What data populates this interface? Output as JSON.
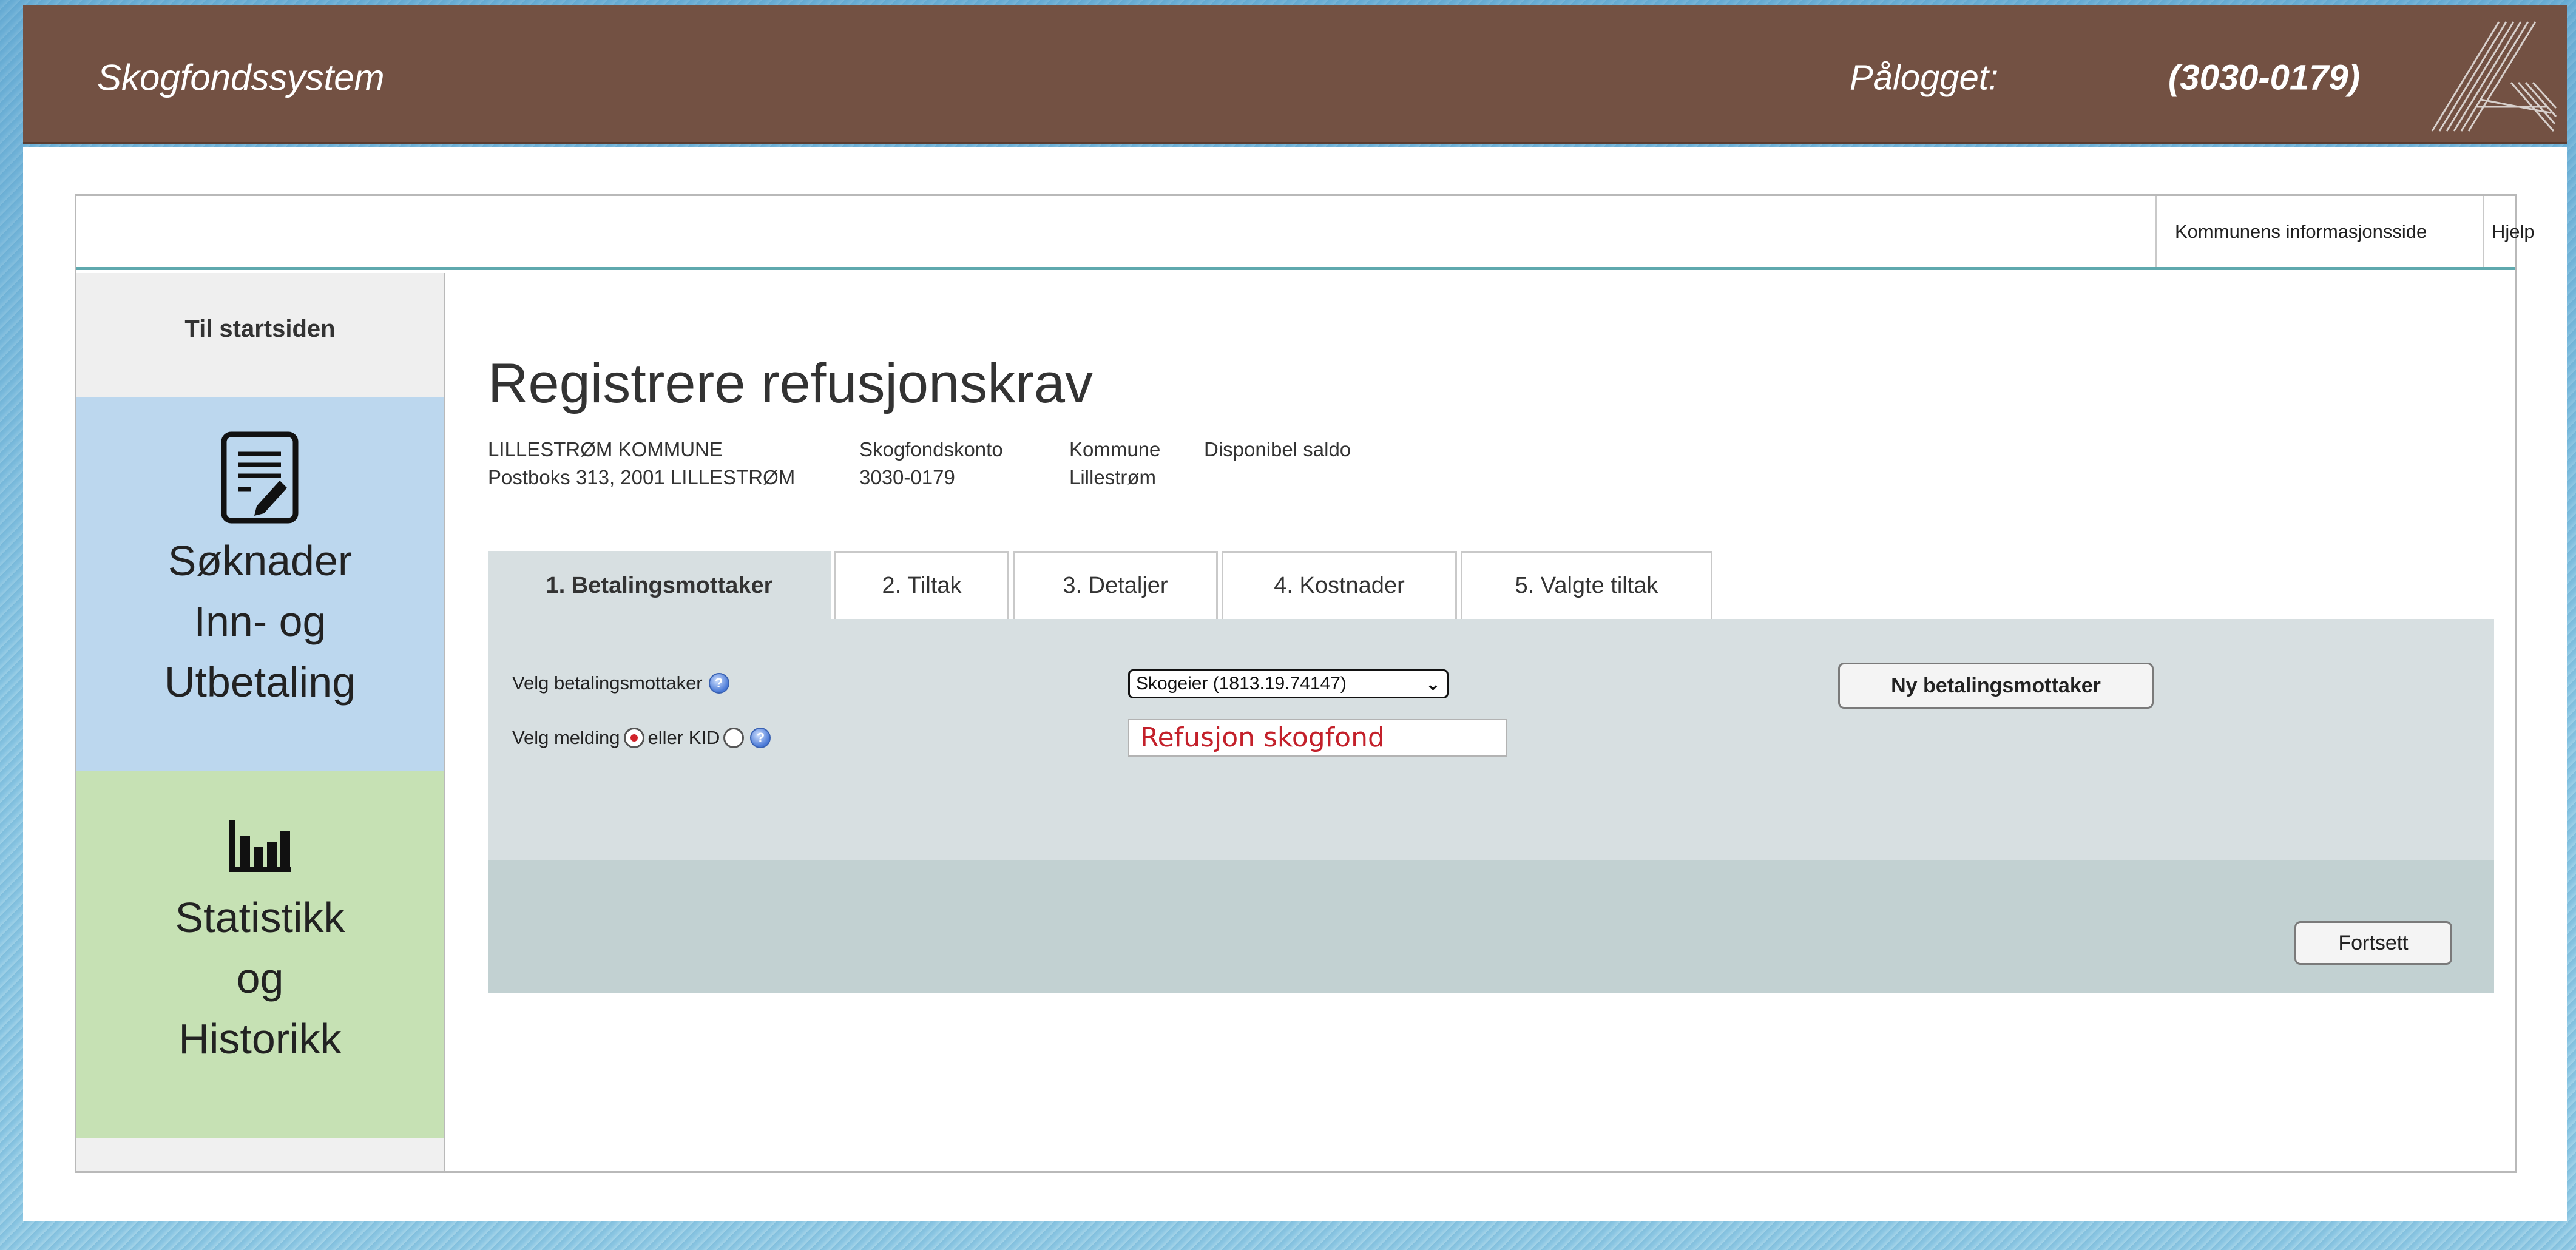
{
  "header": {
    "app_title": "Skogfondssystem",
    "logged_in_label": "Pålogget:",
    "user_id": "(3030-0179)"
  },
  "top_links": {
    "info": "Kommunens informasjonsside",
    "help": "Hjelp"
  },
  "sidebar": {
    "to_start": "Til startsiden",
    "applications": {
      "lines": [
        "Søknader",
        "Inn- og",
        "Utbetaling"
      ],
      "icon": "document-edit-icon"
    },
    "statistics": {
      "lines": [
        "Statistikk",
        "og",
        "Historikk"
      ],
      "icon": "bar-chart-icon"
    }
  },
  "page": {
    "title": "Registrere refusjonskrav",
    "org_name": "LILLESTRØM KOMMUNE",
    "org_address": "Postboks 313, 2001 LILLESTRØM",
    "account_label": "Skogfondskonto",
    "account_value": "3030-0179",
    "municipality_label": "Kommune",
    "municipality_value": "Lillestrøm",
    "balance_label": "Disponibel saldo"
  },
  "tabs": [
    {
      "label": "1. Betalingsmottaker",
      "active": true
    },
    {
      "label": "2. Tiltak",
      "active": false
    },
    {
      "label": "3. Detaljer",
      "active": false
    },
    {
      "label": "4. Kostnader",
      "active": false
    },
    {
      "label": "5. Valgte tiltak",
      "active": false
    }
  ],
  "form": {
    "payee_label": "Velg betalingsmottaker",
    "payee_selected": "Skogeier  (1813.19.74147)",
    "message_label": "Velg melding",
    "or_kid_label": "eller KID",
    "message_value": "Refusjon skogfond",
    "new_payee_button": "Ny betalingsmottaker",
    "continue_button": "Fortsett"
  },
  "colors": {
    "header_bg": "#735143",
    "form_bg": "#d7dfe1",
    "footer_bg": "#c2d1d2",
    "apps_bg": "#bcd7ee",
    "stats_bg": "#c6e1b4",
    "message_text": "#c3202a"
  }
}
